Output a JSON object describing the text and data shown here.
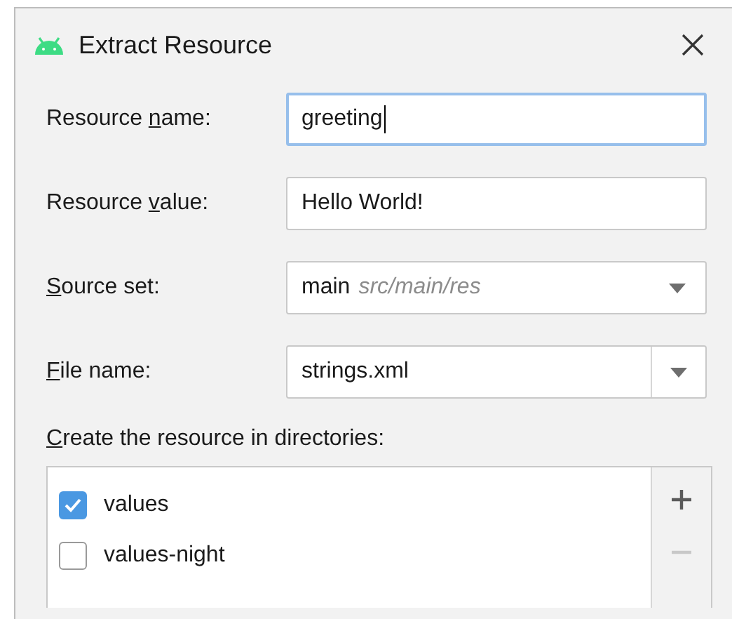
{
  "window": {
    "title": "Extract Resource"
  },
  "fields": [
    {
      "kind": "text",
      "label": {
        "pre": "Resource ",
        "key": "n",
        "post": "ame:"
      },
      "value": "greeting",
      "focused": true
    },
    {
      "kind": "text",
      "label": {
        "pre": "Resource ",
        "key": "v",
        "post": "alue:"
      },
      "value": "Hello World!",
      "focused": false
    },
    {
      "kind": "combo",
      "label": {
        "key": "S",
        "post": "ource set:"
      },
      "value": "main",
      "hint": "src/main/res",
      "focused": false
    },
    {
      "kind": "editable_combo",
      "label": {
        "key": "F",
        "post": "ile name:"
      },
      "value": "strings.xml",
      "focused": false
    }
  ],
  "directories": {
    "label": {
      "key": "C",
      "post": "reate the resource in directories:"
    },
    "items": [
      {
        "name": "values",
        "checked": true
      },
      {
        "name": "values-night",
        "checked": false
      }
    ],
    "tools": [
      {
        "kind": "add",
        "disabled": false
      },
      {
        "kind": "remove",
        "disabled": true
      }
    ]
  }
}
